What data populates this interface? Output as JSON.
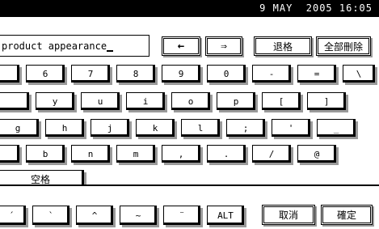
{
  "status": {
    "datetime": "9 MAY  2005 16:05"
  },
  "input": {
    "value": "product appearance"
  },
  "controls": {
    "back_arrow": "←",
    "forward_arrow": "⇒",
    "backspace": "退格",
    "clear_all": "全部刪除"
  },
  "rows": {
    "r1": [
      "6",
      "7",
      "8",
      "9",
      "0",
      "-",
      "=",
      "\\"
    ],
    "r2": [
      "y",
      "u",
      "i",
      "o",
      "p",
      "[",
      "]"
    ],
    "r3": [
      "g",
      "h",
      "j",
      "k",
      "l",
      ";",
      "'",
      "_"
    ],
    "r4": [
      "b",
      "n",
      "m",
      ",",
      ".",
      "/",
      "@"
    ]
  },
  "space": "空格",
  "bottom": {
    "b1": "´",
    "b2": "`",
    "b3": "^",
    "b4": "~",
    "b5": "¨",
    "alt": "ALT",
    "cancel": "取消",
    "ok": "確定"
  }
}
